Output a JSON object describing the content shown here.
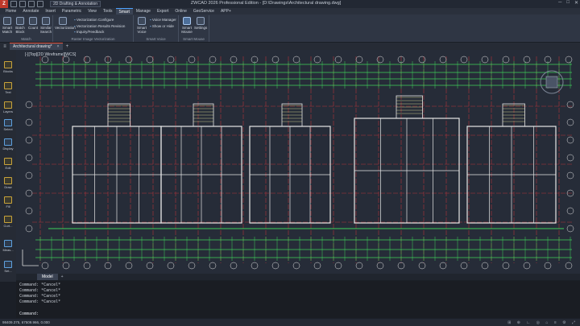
{
  "titlebar": {
    "logo": "Z",
    "workspace": "2D Drafting & Annotation",
    "title": "ZWCAD 2026 Professional Edition - [D:\\Drawings\\Architectural drawing.dwg]",
    "min": "─",
    "max": "□",
    "close": "✕"
  },
  "menu": [
    "Home",
    "Annotate",
    "Insert",
    "Parametric",
    "View",
    "Tools",
    "Smart",
    "Manage",
    "Export",
    "Online",
    "GeoService",
    "APP+"
  ],
  "ribbon": {
    "smart_match": "Smart Match",
    "batch_block": "Batch Block",
    "count": "Count",
    "similar_search": "Similar Search",
    "vectorization": "Vectorization",
    "vec_list": [
      "Vectorization Configure",
      "Vectorization Results Revision",
      "Inquiry/Feedback"
    ],
    "smart_voice": "Smart Voice",
    "voice_list": [
      "Voice Manager",
      "Show or Hide"
    ],
    "smart_mouse": "Smart Mouse",
    "settings": "Settings",
    "group_match": "Match",
    "group_raster": "Raster Image Vectorization",
    "group_voice": "Smart Voice",
    "group_mouse": "Smart Mouse"
  },
  "tabs": {
    "doc": "Architectural drawing*",
    "close": "×",
    "add": "+"
  },
  "sidebar": [
    "Blocks",
    "Text",
    "Layers",
    "Select",
    "Display",
    "Edit",
    "Draw",
    "Fill",
    "Curt...",
    "Meas...",
    "Set..."
  ],
  "view_label": "[-][Top][2D Wireframe][WCS]",
  "model_tab": "Model",
  "model_add": "+",
  "command_lines": [
    "Command: *Cancel*",
    "Command: *Cancel*",
    "Command: *Cancel*",
    "Command: *Cancel*"
  ],
  "command_prompt": "Command:",
  "status": {
    "coords": "98409.375, 67509.966, 0.000",
    "icons": "⊞ ⊕ ∟ ◎ ⌂ ≡ ⚙ ⤢"
  },
  "colors": {
    "accent": "#e0533d",
    "grid_green": "#3fd15a",
    "grid_red": "#b3323a",
    "wall": "#e6e6e6",
    "canvas": "#262c38"
  }
}
